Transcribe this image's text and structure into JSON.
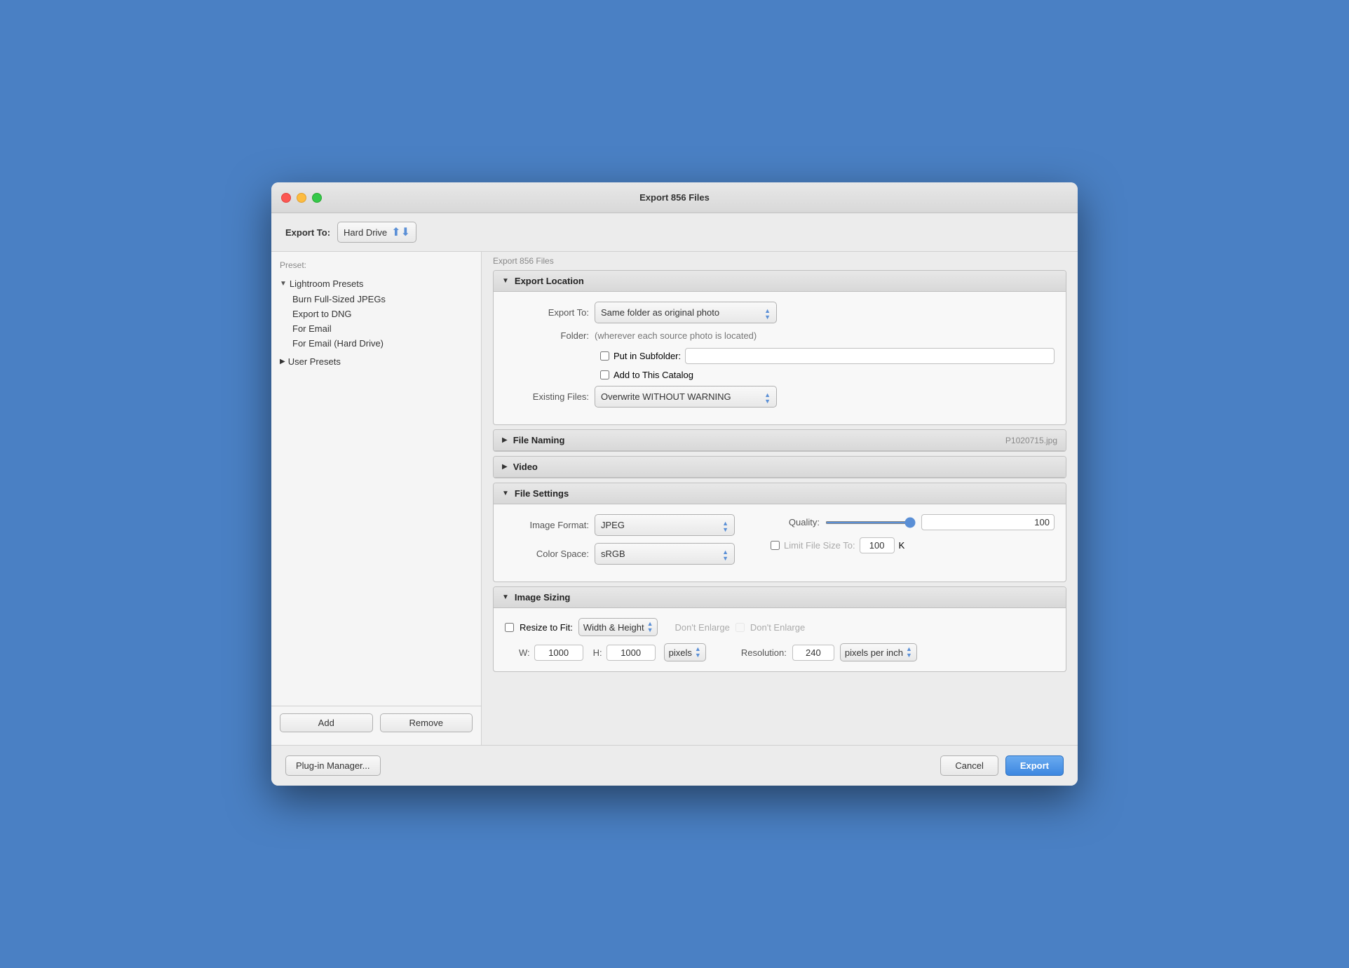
{
  "window": {
    "title": "Export 856 Files"
  },
  "titlebar": {
    "title": "Export 856 Files"
  },
  "exportToBar": {
    "label": "Export To:",
    "value": "Hard Drive"
  },
  "sidebar": {
    "header_label": "Preset:",
    "main_header": "Export 856 Files",
    "lightroom_presets_label": "Lightroom Presets",
    "preset_items": [
      "Burn Full-Sized JPEGs",
      "Export to DNG",
      "For Email",
      "For Email (Hard Drive)"
    ],
    "user_presets_label": "User Presets",
    "add_button": "Add",
    "remove_button": "Remove"
  },
  "sections": {
    "export_location": {
      "title": "Export Location",
      "export_to_label": "Export To:",
      "export_to_value": "Same folder as original photo",
      "folder_label": "Folder:",
      "folder_value": "(wherever each source photo is located)",
      "put_in_subfolder_label": "Put in Subfolder:",
      "subfolder_input": "",
      "add_to_catalog_label": "Add to This Catalog",
      "existing_files_label": "Existing Files:",
      "existing_files_value": "Overwrite WITHOUT WARNING"
    },
    "file_naming": {
      "title": "File Naming",
      "badge": "P1020715.jpg"
    },
    "video": {
      "title": "Video"
    },
    "file_settings": {
      "title": "File Settings",
      "image_format_label": "Image Format:",
      "image_format_value": "JPEG",
      "quality_label": "Quality:",
      "quality_value": "100",
      "color_space_label": "Color Space:",
      "color_space_value": "sRGB",
      "limit_file_size_label": "Limit File Size To:",
      "limit_file_size_value": "100",
      "limit_file_size_unit": "K"
    },
    "image_sizing": {
      "title": "Image Sizing",
      "resize_to_fit_label": "Resize to Fit:",
      "resize_to_fit_value": "Width & Height",
      "dont_enlarge_label": "Don't Enlarge",
      "w_label": "W:",
      "w_value": "1000",
      "h_label": "H:",
      "h_value": "1000",
      "units_value": "pixels",
      "resolution_label": "Resolution:",
      "resolution_value": "240",
      "resolution_unit": "pixels per inch"
    }
  },
  "bottomBar": {
    "plugin_manager_label": "Plug-in Manager...",
    "cancel_label": "Cancel",
    "export_label": "Export"
  }
}
